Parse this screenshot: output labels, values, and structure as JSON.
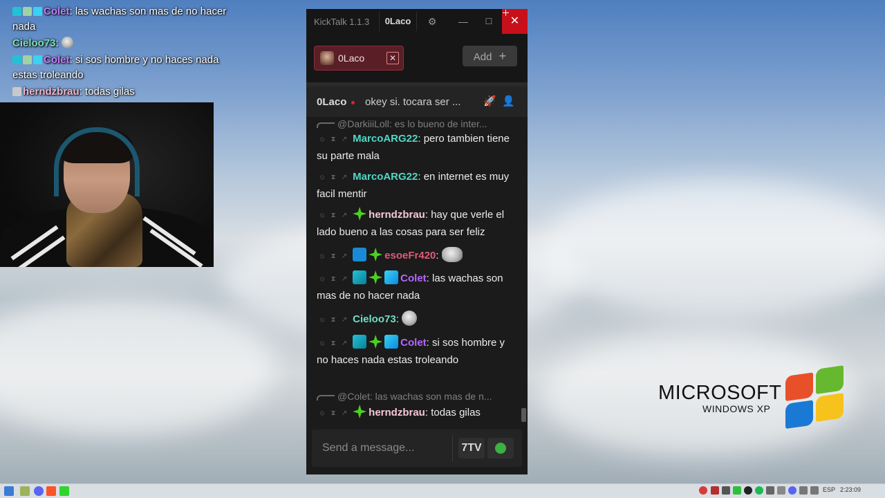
{
  "overlay": {
    "lines": [
      {
        "user": "Colet",
        "text": ": las wachas son mas de no hacer nada"
      },
      {
        "user": "Cieloo73",
        "text": ":"
      },
      {
        "user": "Colet",
        "text": ": si sos hombre y no haces nada estas troleando"
      },
      {
        "user": "herndzbrau",
        "text": ": todas gilas"
      }
    ]
  },
  "window": {
    "app_title": "KickTalk 1.1.3",
    "user_tab": "0Laco",
    "minimize_glyph": "—",
    "maximize_glyph": "☐",
    "close_glyph": "✕",
    "gear_glyph": "⚙"
  },
  "tabs": {
    "channel_name": "0Laco",
    "close_glyph": "✕",
    "add_label": "Add",
    "add_glyph": "+"
  },
  "channel_header": {
    "name": "0Laco",
    "stream_title": "okey si. tocara ser ...",
    "rocket_glyph": "🚀",
    "person_glyph": "👤"
  },
  "messages": [
    {
      "type": "reply",
      "text": "@DarkiiiLoll: es lo bueno de inter..."
    },
    {
      "type": "msg",
      "user": "MarcoARG22",
      "text": "pero tambien tiene su parte mala"
    },
    {
      "type": "msg",
      "user": "MarcoARG22",
      "text": "en internet es muy facil mentir"
    },
    {
      "type": "msg",
      "user": "herndzbrau",
      "text": "hay que verle el lado bueno a las cosas para ser feliz"
    },
    {
      "type": "msg",
      "user": "esoeFr420",
      "text": ""
    },
    {
      "type": "msg",
      "user": "Colet",
      "text": "las wachas son mas de no hacer nada"
    },
    {
      "type": "msg",
      "user": "Cieloo73",
      "text": ""
    },
    {
      "type": "msg",
      "user": "Colet",
      "text": "si sos hombre y no haces nada estas troleando"
    },
    {
      "type": "reply",
      "text": "@Colet: las wachas son mas de n..."
    },
    {
      "type": "msg",
      "user": "herndzbrau",
      "text": "todas gilas"
    }
  ],
  "composer": {
    "placeholder": "Send a message...",
    "seven_tv_label": "7TV"
  },
  "desktop": {
    "brand": "MICROSOFT",
    "product": "WINDOWS XP"
  },
  "taskbar": {
    "language": "ESP",
    "time": "2:23:09"
  },
  "icons": {
    "mod_icons": [
      "ban-icon",
      "timeout-icon",
      "pin-icon"
    ],
    "badges": [
      "og-badge",
      "subscriber-badge",
      "vip-badge",
      "moderator-badge"
    ],
    "emotes": [
      "skull-emote",
      "pointing-emote"
    ]
  },
  "colors": {
    "close_red": "#c8101b",
    "tab_accent": "#5a1e26",
    "marco": "#4fd8c8",
    "herndzbrau": "#f6c8da",
    "esoe": "#e05a7a",
    "colet": "#b666ff",
    "cieloo": "#6fe0c5"
  }
}
